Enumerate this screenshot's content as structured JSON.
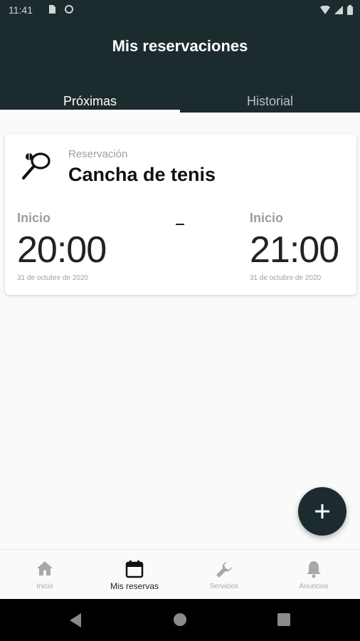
{
  "status_bar": {
    "time": "11:41"
  },
  "app_bar": {
    "title": "Mis reservaciones",
    "tabs": [
      {
        "label": "Próximas",
        "active": true
      },
      {
        "label": "Historial",
        "active": false
      }
    ]
  },
  "reservation": {
    "icon": "tennis-racket-icon",
    "caption": "Reservación",
    "title": "Cancha de tenis",
    "start": {
      "label": "Inicio",
      "time": "20:00",
      "date": "31 de octubre de 2020"
    },
    "end": {
      "label": "Inicio",
      "time": "21:00",
      "date": "31 de octubre de 2020"
    }
  },
  "fab": {
    "icon": "plus-icon"
  },
  "bottom_nav": [
    {
      "label": "Inicio",
      "icon": "home-icon",
      "active": false
    },
    {
      "label": "Mis reservas",
      "icon": "calendar-icon",
      "active": true
    },
    {
      "label": "Servicios",
      "icon": "wrench-icon",
      "active": false
    },
    {
      "label": "Anuncios",
      "icon": "bell-icon",
      "active": false
    }
  ],
  "colors": {
    "primary": "#1c2b2d",
    "background": "#fafafa",
    "muted_text": "#9e9e9e"
  }
}
